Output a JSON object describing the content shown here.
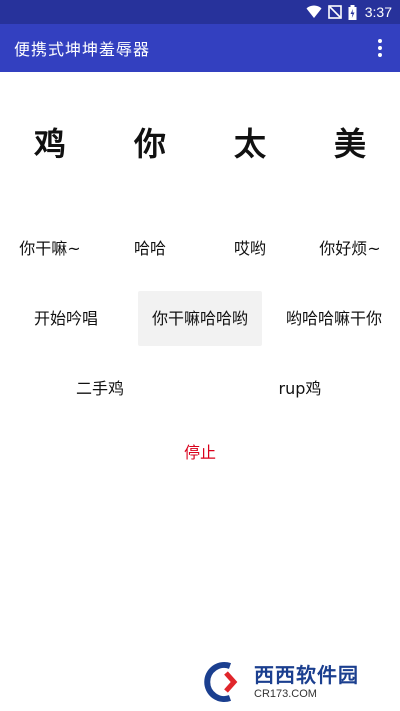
{
  "status_bar": {
    "time": "3:37",
    "icons": [
      "wifi-icon",
      "signal-off-icon",
      "battery-charging-icon"
    ]
  },
  "app_bar": {
    "title": "便携式坤坤羞辱器",
    "menu_icon": "more-vert-icon"
  },
  "big_chars": [
    "鸡",
    "你",
    "太",
    "美"
  ],
  "buttons": {
    "row1": [
      "你干嘛~",
      "哈哈",
      "哎哟",
      "你好烦~"
    ],
    "row2": [
      "开始吟唱",
      "你干嘛哈哈哟",
      "哟哈哈嘛干你"
    ],
    "row3": [
      "二手鸡",
      "rup鸡"
    ],
    "stop": "停止"
  },
  "watermark": {
    "main": "西西软件园",
    "sub": "CR173.COM"
  },
  "colors": {
    "status_bar": "#27329b",
    "app_bar": "#3340c0",
    "stop": "#d9001b"
  }
}
